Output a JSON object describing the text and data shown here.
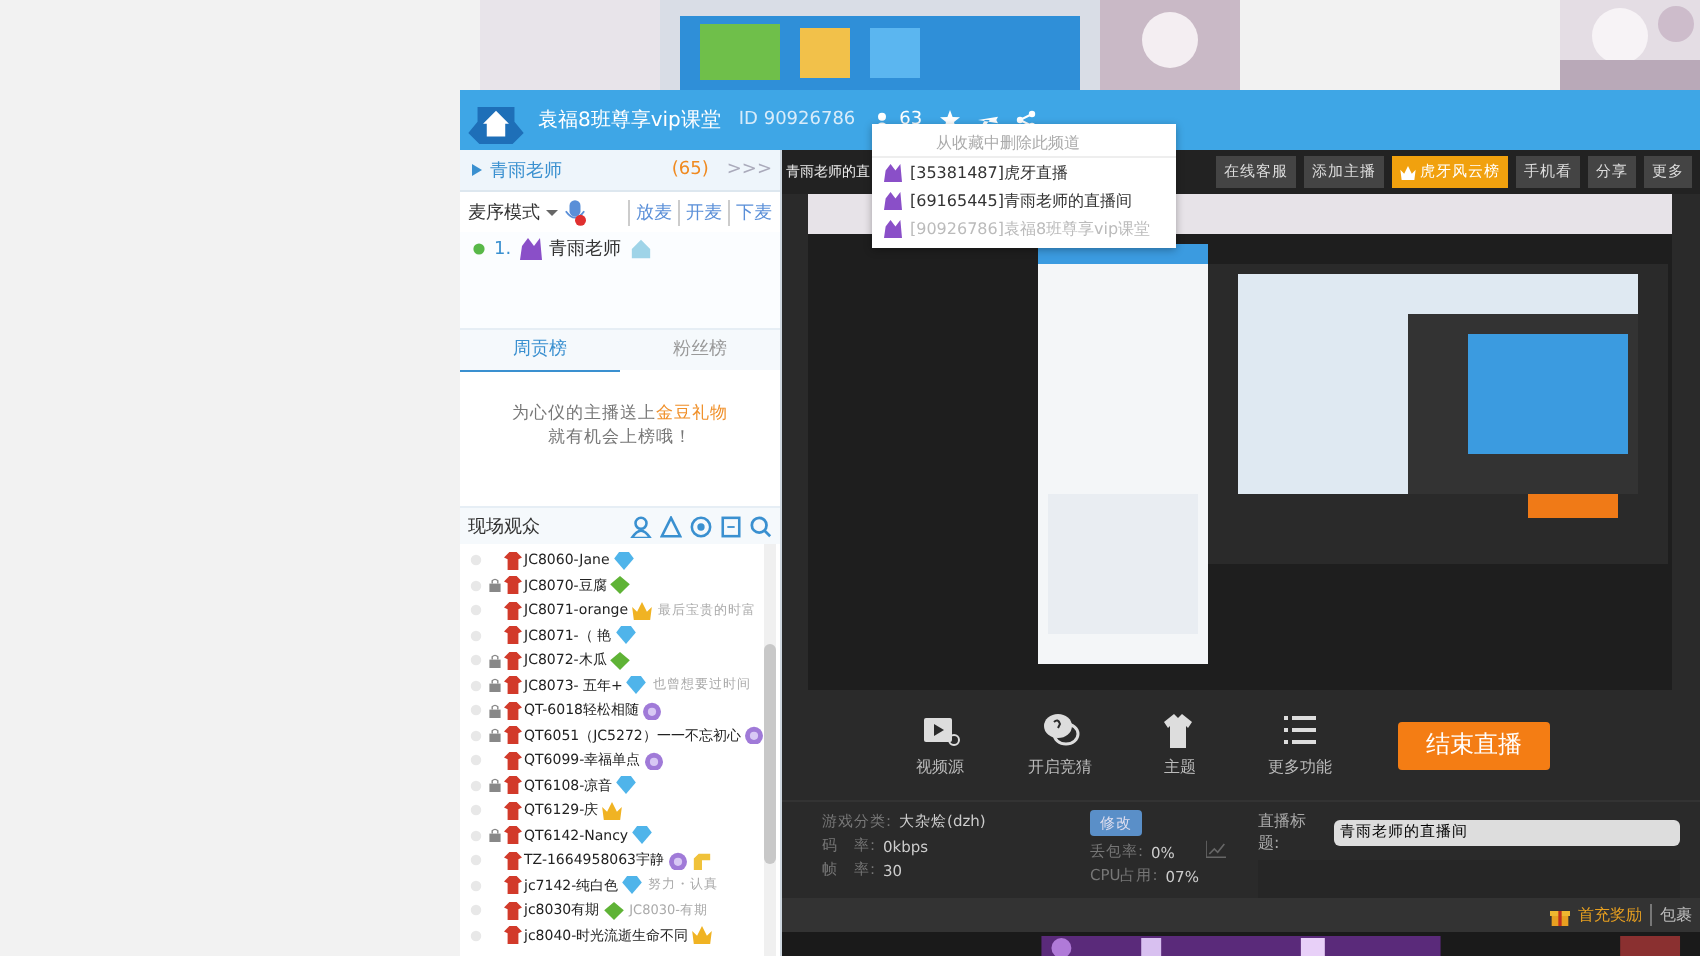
{
  "window": {
    "title": "袁福8班尊享vip课堂",
    "id": "ID 90926786",
    "viewers": "63"
  },
  "favorites_menu": {
    "header": "从收藏中删除此频道",
    "items": [
      {
        "label": "[35381487]虎牙直播",
        "disabled": false
      },
      {
        "label": "[69165445]青雨老师的直播间",
        "disabled": false
      },
      {
        "label": "[90926786]袁福8班尊享vip课堂",
        "disabled": true
      }
    ]
  },
  "sidebar": {
    "channel": {
      "name": "青雨老师",
      "count": "(65)",
      "more": ">>>"
    },
    "mic_mode": "麦序模式",
    "mic_actions": [
      "放麦",
      "开麦",
      "下麦"
    ],
    "queue": [
      {
        "number": "1.",
        "name": "青雨老师"
      }
    ],
    "rank_tabs": [
      {
        "label": "周贡榜",
        "selected": true
      },
      {
        "label": "粉丝榜",
        "selected": false
      }
    ],
    "rank_hint": [
      "为心仪的主播送上**金豆礼物**",
      "就有机会上榜哦！"
    ],
    "audience_title": "现场观众",
    "audience": [
      {
        "name": "JC8060-Jane",
        "kind": "diamond",
        "hand": false,
        "locked": false
      },
      {
        "name": "JC8070-豆腐",
        "kind": "gem",
        "hand": false,
        "locked": true
      },
      {
        "name": "JC8071-orange",
        "kind": "crown",
        "hand": false,
        "locked": false,
        "note": "最后宝贵的时富"
      },
      {
        "name": "JC8071-（ 艳",
        "kind": "diamond",
        "hand": false,
        "locked": false
      },
      {
        "name": "JC8072-木瓜",
        "kind": "gem",
        "hand": false,
        "locked": true
      },
      {
        "name": "JC8073- 五年+",
        "kind": "diamond",
        "hand": false,
        "locked": true,
        "note": "也曾想要过时间"
      },
      {
        "name": "QT-6018轻松相随",
        "kind": "medal",
        "hand": false,
        "locked": true
      },
      {
        "name": "QT6051（JC5272）一一不忘初心",
        "kind": "medal",
        "hand": false,
        "locked": true
      },
      {
        "name": "QT6099-幸福单点",
        "kind": "medal",
        "hand": false,
        "locked": false
      },
      {
        "name": "QT6108-凉音",
        "kind": "diamond",
        "hand": false,
        "locked": true
      },
      {
        "name": "QT6129-庆",
        "kind": "crown",
        "hand": false,
        "locked": false
      },
      {
        "name": "QT6142-Nancy",
        "kind": "diamond",
        "hand": false,
        "locked": true
      },
      {
        "name": "TZ-1664958063宇静",
        "kind": "medal",
        "hand": true,
        "locked": false
      },
      {
        "name": "jc7142-纯白色",
        "kind": "diamond",
        "hand": false,
        "locked": false,
        "note": "努力・认真"
      },
      {
        "name": "jc8030有期",
        "kind": "gem",
        "hand": false,
        "locked": false,
        "note": "JC8030-有期"
      },
      {
        "name": "jc8040-时光流逝生命不同",
        "kind": "crown",
        "hand": false,
        "locked": false
      }
    ]
  },
  "toolbar": {
    "title": "青雨老师的直",
    "buttons": [
      {
        "label": "在线客服",
        "highlight": false
      },
      {
        "label": "添加主播",
        "highlight": false
      },
      {
        "label": "虎牙风云榜",
        "highlight": true
      },
      {
        "label": "手机看",
        "highlight": false
      },
      {
        "label": "分享",
        "highlight": false
      },
      {
        "label": "更多",
        "highlight": false
      }
    ]
  },
  "controls": [
    {
      "label": "视频源",
      "kind": "video"
    },
    {
      "label": "开启竞猜",
      "kind": "chat"
    },
    {
      "label": "主题",
      "kind": "shirt"
    },
    {
      "label": "更多功能",
      "kind": "list"
    }
  ],
  "end_button": "结束直播",
  "stats": [
    {
      "label": "游戏分类:",
      "value": "大杂烩(dzh)"
    },
    {
      "label": "码　率:",
      "value": "0kbps"
    },
    {
      "label": "帧　率:",
      "value": "30"
    }
  ],
  "edit_button": "修改",
  "perf": [
    {
      "label": "丢包率:",
      "value": "0%"
    },
    {
      "label": "CPU占用:",
      "value": "07%"
    }
  ],
  "title_field": {
    "label": "直播标题:",
    "value": "青雨老师的直播间"
  },
  "footer": {
    "links": [
      "首充奖励",
      "包裹"
    ]
  }
}
